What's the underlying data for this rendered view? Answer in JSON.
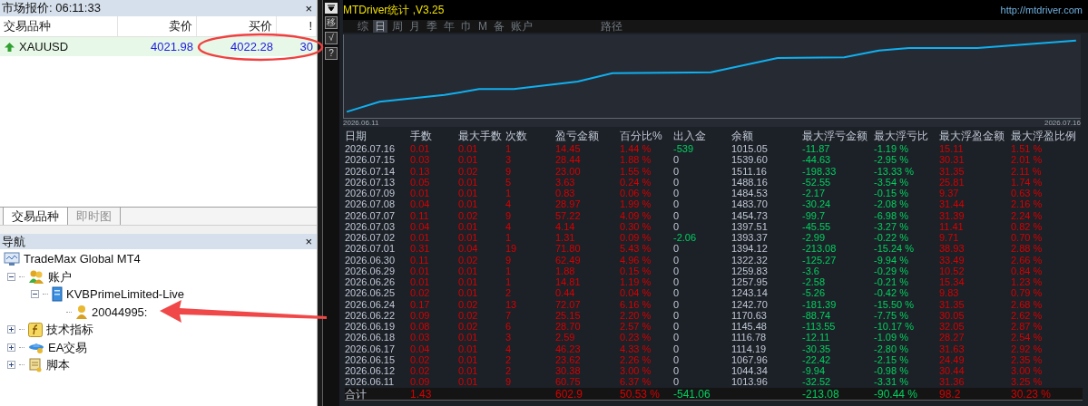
{
  "market_watch": {
    "title": "市场报价: 06:11:33",
    "close": "×",
    "columns": [
      "交易品种",
      "卖价",
      "买价",
      "!"
    ],
    "rows": [
      {
        "symbol": "XAUUSD",
        "bid": "4021.98",
        "ask": "4022.28",
        "spread": "30",
        "selected": true
      }
    ],
    "tabs": [
      {
        "label": "交易品种",
        "selected": true
      },
      {
        "label": "即时图",
        "selected": false
      }
    ]
  },
  "navigator": {
    "title": "导航",
    "close": "×",
    "tree": [
      {
        "label": "TradeMax Global MT4",
        "kind": "terminal",
        "children": [
          {
            "label": "账户",
            "kind": "accounts",
            "expanded": true,
            "children": [
              {
                "label": "KVBPrimeLimited-Live",
                "kind": "server",
                "expanded": true,
                "children": [
                  {
                    "label": "20044995:",
                    "kind": "account"
                  }
                ]
              }
            ]
          },
          {
            "label": "技术指标",
            "kind": "indicators",
            "expanded": false
          },
          {
            "label": "EA交易",
            "kind": "experts",
            "expanded": false
          },
          {
            "label": "脚本",
            "kind": "scripts",
            "expanded": false
          }
        ]
      }
    ]
  },
  "stats": {
    "title": "MTDriver统计 ,V3.25",
    "url": "http://mtdriver.com",
    "toolbar": [
      "移",
      "√",
      "?"
    ],
    "periods": [
      {
        "label": "综",
        "selected": false
      },
      {
        "label": "日",
        "selected": true
      },
      {
        "label": "周",
        "selected": false
      },
      {
        "label": "月",
        "selected": false
      },
      {
        "label": "季",
        "selected": false
      },
      {
        "label": "年",
        "selected": false
      },
      {
        "label": "巾",
        "selected": false
      },
      {
        "label": "M",
        "selected": false
      },
      {
        "label": "备",
        "selected": false
      },
      {
        "label": "账户",
        "selected": false
      }
    ],
    "path_label": "路径",
    "chart": {
      "start": "2026.06.11",
      "end": "2026.07.16"
    },
    "columns": [
      {
        "label": "日期",
        "kind": "plain"
      },
      {
        "label": "手数",
        "kind": "profit"
      },
      {
        "label": "最大手数",
        "kind": "profit"
      },
      {
        "label": "次数",
        "kind": "profit"
      },
      {
        "label": "盈亏金额",
        "kind": "profit"
      },
      {
        "label": "百分比%",
        "kind": "profit"
      },
      {
        "label": "出入金",
        "kind": "flow"
      },
      {
        "label": "余额",
        "kind": "plain"
      },
      {
        "label": "最大浮亏金额",
        "kind": "drawdown"
      },
      {
        "label": "最大浮亏比",
        "kind": "drawdown"
      },
      {
        "label": "最大浮盈金额",
        "kind": "profit"
      },
      {
        "label": "最大浮盈比例",
        "kind": "profit"
      }
    ],
    "rows": [
      {
        "cells": [
          "2026.07.16",
          "0.01",
          "0.01",
          "1",
          "14.45",
          "1.44 %",
          "-539",
          "1015.05",
          "-11.87",
          "-1.19 %",
          "15.11",
          "1.51 %"
        ],
        "flow_marked": true
      },
      {
        "cells": [
          "2026.07.15",
          "0.03",
          "0.01",
          "3",
          "28.44",
          "1.88 %",
          "0",
          "1539.60",
          "-44.63",
          "-2.95 %",
          "30.31",
          "2.01 %"
        ],
        "flow_marked": false
      },
      {
        "cells": [
          "2026.07.14",
          "0.13",
          "0.02",
          "9",
          "23.00",
          "1.55 %",
          "0",
          "1511.16",
          "-198.33",
          "-13.33 %",
          "31.35",
          "2.11 %"
        ],
        "flow_marked": false
      },
      {
        "cells": [
          "2026.07.13",
          "0.05",
          "0.01",
          "5",
          "3.63",
          "0.24 %",
          "0",
          "1488.16",
          "-52.55",
          "-3.54 %",
          "25.81",
          "1.74 %"
        ],
        "flow_marked": false
      },
      {
        "cells": [
          "2026.07.09",
          "0.01",
          "0.01",
          "1",
          "0.83",
          "0.06 %",
          "0",
          "1484.53",
          "-2.17",
          "-0.15 %",
          "9.37",
          "0.63 %"
        ],
        "flow_marked": false
      },
      {
        "cells": [
          "2026.07.08",
          "0.04",
          "0.01",
          "4",
          "28.97",
          "1.99 %",
          "0",
          "1483.70",
          "-30.24",
          "-2.08 %",
          "31.44",
          "2.16 %"
        ],
        "flow_marked": false
      },
      {
        "cells": [
          "2026.07.07",
          "0.11",
          "0.02",
          "9",
          "57.22",
          "4.09 %",
          "0",
          "1454.73",
          "-99.7",
          "-6.98 %",
          "31.39",
          "2.24 %"
        ],
        "flow_marked": false
      },
      {
        "cells": [
          "2026.07.03",
          "0.04",
          "0.01",
          "4",
          "4.14",
          "0.30 %",
          "0",
          "1397.51",
          "-45.55",
          "-3.27 %",
          "11.41",
          "0.82 %"
        ],
        "flow_marked": false
      },
      {
        "cells": [
          "2026.07.02",
          "0.01",
          "0.01",
          "1",
          "1.31",
          "0.09 %",
          "-2.06",
          "1393.37",
          "-2.99",
          "-0.22 %",
          "9.71",
          "0.70 %"
        ],
        "flow_marked": true
      },
      {
        "cells": [
          "2026.07.01",
          "0.31",
          "0.04",
          "19",
          "71.80",
          "5.43 %",
          "0",
          "1394.12",
          "-213.08",
          "-15.24 %",
          "38.93",
          "2.88 %"
        ],
        "flow_marked": false
      },
      {
        "cells": [
          "2026.06.30",
          "0.11",
          "0.02",
          "9",
          "62.49",
          "4.96 %",
          "0",
          "1322.32",
          "-125.27",
          "-9.94 %",
          "33.49",
          "2.66 %"
        ],
        "flow_marked": false
      },
      {
        "cells": [
          "2026.06.29",
          "0.01",
          "0.01",
          "1",
          "1.88",
          "0.15 %",
          "0",
          "1259.83",
          "-3.6",
          "-0.29 %",
          "10.52",
          "0.84 %"
        ],
        "flow_marked": false
      },
      {
        "cells": [
          "2026.06.26",
          "0.01",
          "0.01",
          "1",
          "14.81",
          "1.19 %",
          "0",
          "1257.95",
          "-2.58",
          "-0.21 %",
          "15.34",
          "1.23 %"
        ],
        "flow_marked": false
      },
      {
        "cells": [
          "2026.06.25",
          "0.02",
          "0.01",
          "2",
          "0.44",
          "0.04 %",
          "0",
          "1243.14",
          "-5.26",
          "-0.42 %",
          "9.83",
          "0.79 %"
        ],
        "flow_marked": false
      },
      {
        "cells": [
          "2026.06.24",
          "0.17",
          "0.02",
          "13",
          "72.07",
          "6.16 %",
          "0",
          "1242.70",
          "-181.39",
          "-15.50 %",
          "31.35",
          "2.68 %"
        ],
        "flow_marked": false
      },
      {
        "cells": [
          "2026.06.22",
          "0.09",
          "0.02",
          "7",
          "25.15",
          "2.20 %",
          "0",
          "1170.63",
          "-88.74",
          "-7.75 %",
          "30.05",
          "2.62 %"
        ],
        "flow_marked": false
      },
      {
        "cells": [
          "2026.06.19",
          "0.08",
          "0.02",
          "6",
          "28.70",
          "2.57 %",
          "0",
          "1145.48",
          "-113.55",
          "-10.17 %",
          "32.05",
          "2.87 %"
        ],
        "flow_marked": false
      },
      {
        "cells": [
          "2026.06.18",
          "0.03",
          "0.01",
          "3",
          "2.59",
          "0.23 %",
          "0",
          "1116.78",
          "-12.11",
          "-1.09 %",
          "28.27",
          "2.54 %"
        ],
        "flow_marked": false
      },
      {
        "cells": [
          "2026.06.17",
          "0.04",
          "0.01",
          "4",
          "46.23",
          "4.33 %",
          "0",
          "1114.19",
          "-30.35",
          "-2.80 %",
          "31.63",
          "2.92 %"
        ],
        "flow_marked": false
      },
      {
        "cells": [
          "2026.06.15",
          "0.02",
          "0.01",
          "2",
          "23.62",
          "2.26 %",
          "0",
          "1067.96",
          "-22.42",
          "-2.15 %",
          "24.49",
          "2.35 %"
        ],
        "flow_marked": false
      },
      {
        "cells": [
          "2026.06.12",
          "0.02",
          "0.01",
          "2",
          "30.38",
          "3.00 %",
          "0",
          "1044.34",
          "-9.94",
          "-0.98 %",
          "30.44",
          "3.00 %"
        ],
        "flow_marked": false
      },
      {
        "cells": [
          "2026.06.11",
          "0.09",
          "0.01",
          "9",
          "60.75",
          "6.37 %",
          "0",
          "1013.96",
          "-32.52",
          "-3.31 %",
          "31.36",
          "3.25 %"
        ],
        "flow_marked": false
      }
    ],
    "totals": {
      "cells": [
        "合计",
        "1.43",
        null,
        null,
        "602.9",
        "50.53 %",
        "-541.06",
        null,
        "-213.08",
        "-90.44 %",
        "98.2",
        "30.23 %"
      ],
      "flow_marked": true
    }
  }
}
